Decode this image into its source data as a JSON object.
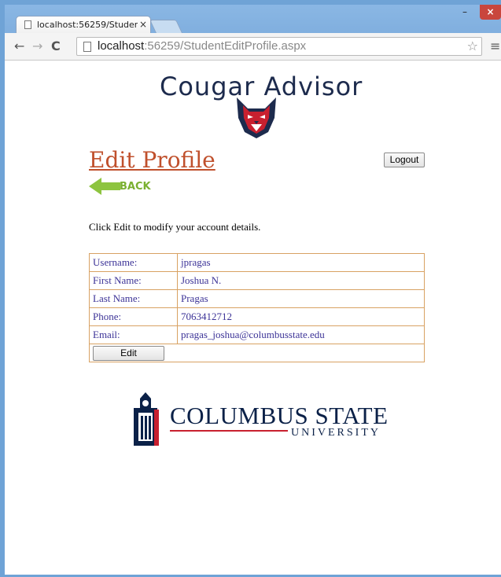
{
  "browser": {
    "tab_title": "localhost:56259/StudentE:",
    "tab_close": "×",
    "url_host": "localhost",
    "url_rest": ":56259/StudentEditProfile.aspx",
    "star_icon": "☆",
    "menu_icon": "≡",
    "back_icon": "←",
    "forward_icon": "→",
    "reload_icon": "C",
    "window_min": "–",
    "window_max": "□",
    "window_close": "×"
  },
  "header": {
    "logo_text": "Cougar Advisor"
  },
  "page": {
    "title": "Edit Profile",
    "logout_label": "Logout",
    "back_label": "BACK",
    "instructions": "Click Edit to modify your account details."
  },
  "profile": {
    "rows": [
      {
        "label": "Username:",
        "value": "jpragas"
      },
      {
        "label": "First Name:",
        "value": "Joshua N."
      },
      {
        "label": "Last Name:",
        "value": "Pragas"
      },
      {
        "label": "Phone:",
        "value": "7063412712"
      },
      {
        "label": "Email:",
        "value": "pragas_joshua@columbusstate.edu"
      }
    ],
    "edit_label": "Edit"
  },
  "footer": {
    "logo_name": "COLUMBUS STATE",
    "logo_sub": "UNIVERSITY"
  },
  "colors": {
    "title": "#c0502c",
    "table_border": "#d8a263",
    "table_text": "#3c3397",
    "csu_navy": "#0b2148",
    "csu_red": "#c8202f"
  }
}
